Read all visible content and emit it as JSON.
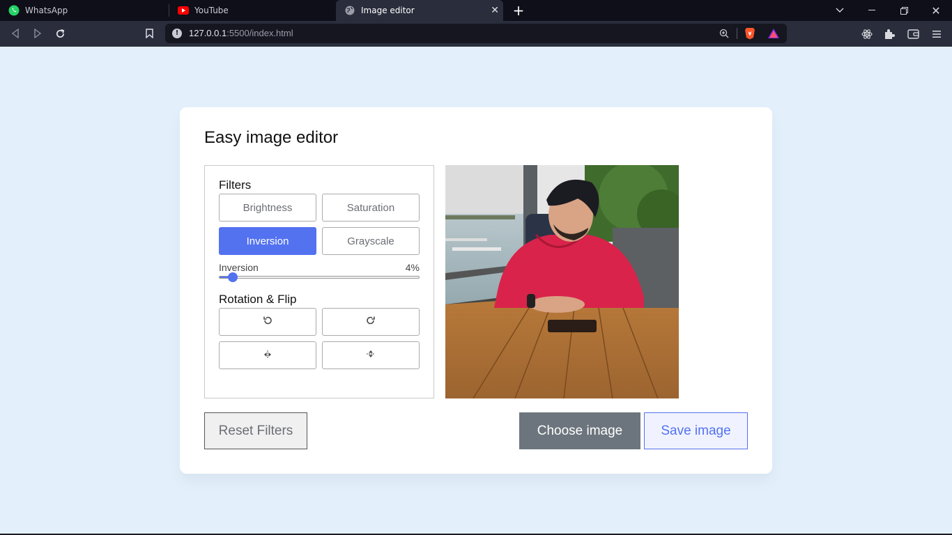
{
  "browser": {
    "tabs": [
      {
        "title": "WhatsApp",
        "icon": "whatsapp-icon",
        "active": false
      },
      {
        "title": "YouTube",
        "icon": "youtube-icon",
        "active": false
      },
      {
        "title": "Image editor",
        "icon": "globe-icon",
        "active": true
      }
    ],
    "url_host": "127.0.0.1",
    "url_rest": ":5500/index.html"
  },
  "app": {
    "title": "Easy image editor",
    "filters_title": "Filters",
    "filters": [
      {
        "label": "Brightness",
        "active": false
      },
      {
        "label": "Saturation",
        "active": false
      },
      {
        "label": "Inversion",
        "active": true
      },
      {
        "label": "Grayscale",
        "active": false
      }
    ],
    "slider": {
      "label": "Inversion",
      "value_text": "4%",
      "value": 4,
      "max": 100
    },
    "rotate_title": "Rotation & Flip",
    "rotate_buttons": [
      "rotate-left-icon",
      "rotate-right-icon",
      "flip-horizontal-icon",
      "flip-vertical-icon"
    ],
    "reset_label": "Reset Filters",
    "choose_label": "Choose image",
    "save_label": "Save image"
  },
  "colors": {
    "accent": "#5372f0",
    "background": "#e3f0fc",
    "secondary": "#6c757d"
  }
}
